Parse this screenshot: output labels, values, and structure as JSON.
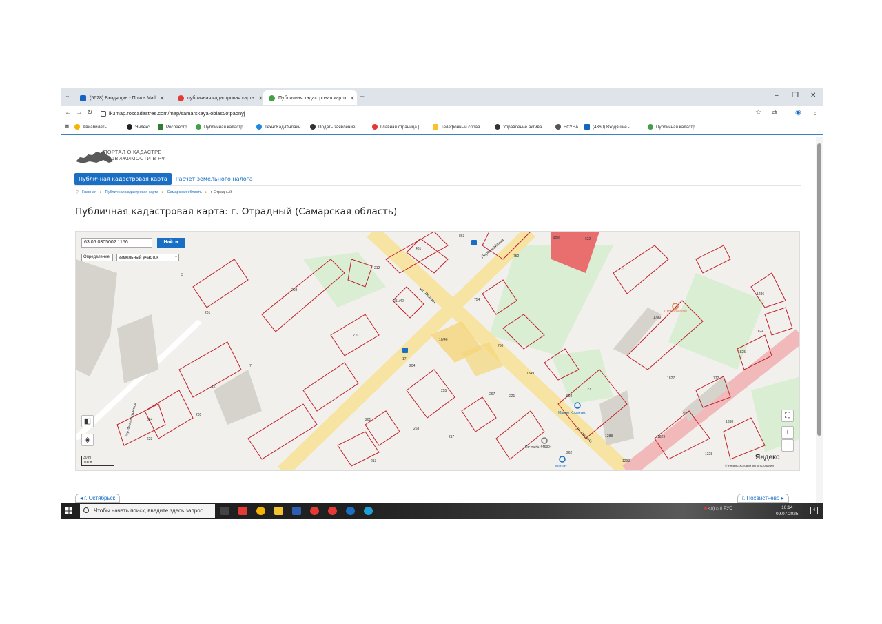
{
  "browser": {
    "tabs": [
      {
        "title": "(5628) Входящие - Почта Mail",
        "icon_color": "#1565c0",
        "active": false
      },
      {
        "title": "публичная кадастровая карта",
        "icon_color": "#e53935",
        "active": false
      },
      {
        "title": "Публичная кадастровая карто",
        "icon_color": "#43a047",
        "active": true
      }
    ],
    "new_tab": "+",
    "url": "ik3map.roscadastres.com/map/samarskaya-oblast/otpadnyj",
    "bookmarks": [
      {
        "label": "Авиабилеты",
        "color": "#f4b400"
      },
      {
        "label": "Яндекс",
        "color": "#222222"
      },
      {
        "label": "Росреестр",
        "color": "#2e7d32"
      },
      {
        "label": "Публичная кадастр...",
        "color": "#43a047"
      },
      {
        "label": "ТехноКад-Онлайн",
        "color": "#1e88e5"
      },
      {
        "label": "Подать заявление...",
        "color": "#333333"
      },
      {
        "label": "Главная страница |...",
        "color": "#e53935"
      },
      {
        "label": "Телефонный справ...",
        "color": "#fbc02d"
      },
      {
        "label": "Управление актива...",
        "color": "#333333"
      },
      {
        "label": "ЕСУНА",
        "color": "#555555"
      },
      {
        "label": "(4360) Входящие -...",
        "color": "#1565c0"
      },
      {
        "label": "Публичная кадастр...",
        "color": "#43a047"
      }
    ]
  },
  "site": {
    "logo_line1": "ПОРТАЛ О КАДАСТРЕ",
    "logo_line2": "НЕДВИЖИМОСТИ В РФ",
    "nav_tabs": [
      "Публичная кадастровая карта",
      "Расчет земельного налога"
    ],
    "breadcrumb": [
      "Главная",
      "Публичная кадастровая карта",
      "Самарская область",
      "г. Отрадный"
    ],
    "title": "Публичная кадастровая карта: г. Отрадный (Самарская область)"
  },
  "map": {
    "search_value": "63:06:0305002:1156",
    "search_button": "Найти",
    "definition_label": "Определение:",
    "definition_value": "земельный участок",
    "scale_top": "30 m",
    "scale_bottom": "100 ft",
    "brand": "Яндекс",
    "copyright": "© Яндекс  Условия использования",
    "street_labels": [
      "ул. Ленина",
      "ул. Ленина",
      "Первомайская",
      "пер. Физкультурников"
    ],
    "poi_labels": [
      "Магнит Косметик",
      "Стоматология",
      "Почта № 446304",
      "Магнит",
      "Дом"
    ],
    "parcel_labels": [
      "212",
      "401",
      "863",
      "752",
      "622",
      "203",
      "201",
      "211/42",
      "754",
      "210",
      "10/40",
      "750",
      "773",
      "1286",
      "1799",
      "1824",
      "17",
      "204",
      "1849",
      "1825",
      "1827",
      "772",
      "7",
      "12",
      "255",
      "267",
      "221",
      "894",
      "27",
      "771",
      "1838",
      "205",
      "201",
      "268",
      "217",
      "1288",
      "1829",
      "623",
      "213",
      "262",
      "1293",
      "1328",
      "3",
      "624"
    ]
  },
  "nav": {
    "prev_city": "г. Октябрьск",
    "next_city": "г. Похвистнево"
  },
  "taskbar": {
    "search_placeholder": "Чтобы начать поиск, введите здесь запрос",
    "lang": "РУС",
    "time": "16:14",
    "date": "09.07.2025",
    "notifications": "4"
  }
}
